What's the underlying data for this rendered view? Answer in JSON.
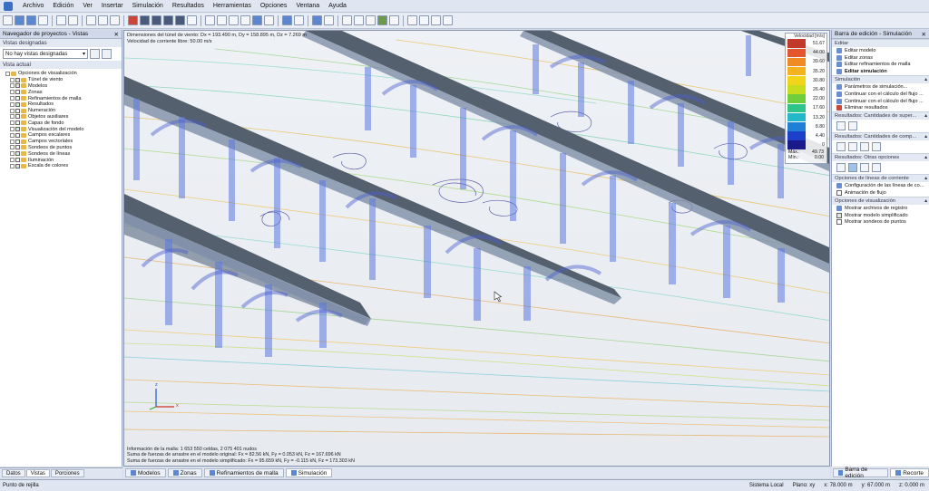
{
  "menu": [
    "Archivo",
    "Edición",
    "Ver",
    "Insertar",
    "Simulación",
    "Resultados",
    "Herramientas",
    "Opciones",
    "Ventana",
    "Ayuda"
  ],
  "left_panel": {
    "title": "Navegador de proyectos - Vistas",
    "section_designed": "Vistas designadas",
    "dropdown_value": "No hay vistas designadas",
    "section_current": "Vista actual",
    "tree": [
      {
        "label": "Opciones de visualización",
        "level": 0
      },
      {
        "label": "Túnel de viento",
        "level": 1
      },
      {
        "label": "Modelos",
        "level": 1
      },
      {
        "label": "Zonas",
        "level": 1
      },
      {
        "label": "Refinamientos de malla",
        "level": 1
      },
      {
        "label": "Resultados",
        "level": 1
      },
      {
        "label": "Numeración",
        "level": 1
      },
      {
        "label": "Objetos auxiliares",
        "level": 1
      },
      {
        "label": "Capas de fondo",
        "level": 1
      },
      {
        "label": "Visualización del modelo",
        "level": 1
      },
      {
        "label": "Campos escalares",
        "level": 1
      },
      {
        "label": "Campos vectoriales",
        "level": 1
      },
      {
        "label": "Sondeos de puntos",
        "level": 1
      },
      {
        "label": "Sondeos de líneas",
        "level": 1
      },
      {
        "label": "Iluminación",
        "level": 1
      },
      {
        "label": "Escala de colores",
        "level": 1
      }
    ],
    "tabs": [
      "Datos",
      "Vistas",
      "Porciones"
    ]
  },
  "viewport": {
    "info_top": [
      "Dimensiones del túnel de viento: Dx = 193.490 m, Dy = 158.895 m, Dz = 7.269 m",
      "Velocidad de corriente libre: 50.00 m/s"
    ],
    "info_bottom": [
      "Información de la malla: 1 653 550 celdas, 2 075 401 nudos",
      "Suma de fuerzas de arrastre en el modelo original: Fx = 82.56 kN, Fy = 0.053 kN, Fz = 167.696 kN",
      "Suma de fuerzas de arrastre en el modelo simplificado: Fx = 95.659 kN, Fy = -0.115 kN, Fz = 173.303 kN"
    ],
    "legend_title": "Velocidad [m/s]",
    "legend": [
      {
        "color": "#c0392b",
        "value": "51.67"
      },
      {
        "color": "#e4572e",
        "value": "44.00"
      },
      {
        "color": "#f08a24",
        "value": "39.60"
      },
      {
        "color": "#f4b21e",
        "value": "35.20"
      },
      {
        "color": "#f2d41a",
        "value": "30.80"
      },
      {
        "color": "#c9dd1f",
        "value": "26.40"
      },
      {
        "color": "#6fcf3a",
        "value": "22.00"
      },
      {
        "color": "#2fc48a",
        "value": "17.60"
      },
      {
        "color": "#23b7c9",
        "value": "13.20"
      },
      {
        "color": "#1f7fd6",
        "value": "8.80"
      },
      {
        "color": "#1d3fc9",
        "value": "4.40"
      },
      {
        "color": "#1a1a8a",
        "value": "0"
      }
    ],
    "legend_max_label": "Máx.:",
    "legend_max": "49.73",
    "legend_min_label": "Mín.:",
    "legend_min": "0.00",
    "axis_x": "x",
    "axis_z": "z"
  },
  "view_tabs": [
    "Modelos",
    "Zonas",
    "Refinamientos de malla",
    "Simulación"
  ],
  "right_panel": {
    "title": "Barra de edición - Simulación",
    "sections": [
      {
        "title": "Editar",
        "items": [
          "Editar modelo",
          "Editar zonas",
          "Editar refinamientos de malla",
          "Editar simulación"
        ]
      },
      {
        "title": "Simulación",
        "items": [
          "Parámetros de simulación...",
          "Continuar con el cálculo del flujo ...",
          "Continuar con el cálculo del flujo ...",
          "Eliminar resultados"
        ]
      },
      {
        "title": "Resultados: Cantidades de super..."
      },
      {
        "title": "Resultados: Cantidades de comp..."
      },
      {
        "title": "Resultados: Otras opciones"
      },
      {
        "title": "Opciones de líneas de corriente",
        "items": [
          "Configuración de las líneas de co...",
          "Animación de flujo"
        ]
      },
      {
        "title": "Opciones de visualización",
        "items": [
          "Mostrar archivos de registro",
          "Mostrar modelo simplificado",
          "Mostrar sondeos de puntos"
        ]
      }
    ],
    "tabs": [
      "Barra de edición",
      "Recorte"
    ]
  },
  "status": {
    "left": "Punto de rejilla",
    "system": "Sistema Local",
    "plane": "Plano: xy",
    "x": "x: 78.000 m",
    "y": "y: 67.000 m",
    "z": "z: 0.000 m"
  }
}
